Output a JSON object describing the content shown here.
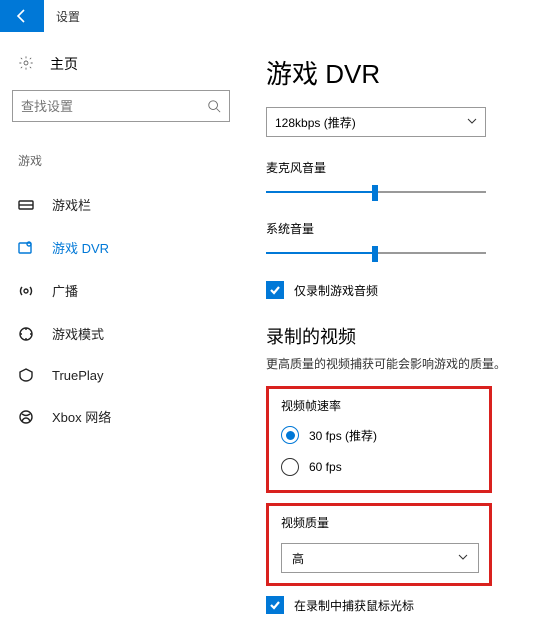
{
  "header": {
    "back_icon": "back",
    "title": "设置"
  },
  "sidebar": {
    "home_label": "主页",
    "search_placeholder": "查找设置",
    "category": "游戏",
    "items": [
      {
        "label": "游戏栏"
      },
      {
        "label": "游戏 DVR",
        "active": true
      },
      {
        "label": "广播"
      },
      {
        "label": "游戏模式"
      },
      {
        "label": "TruePlay"
      },
      {
        "label": "Xbox 网络"
      }
    ]
  },
  "main": {
    "title": "游戏 DVR",
    "bitrate_select": "128kbps (推荐)",
    "mic_label": "麦克风音量",
    "mic_value_pct": 48,
    "sys_label": "系统音量",
    "sys_value_pct": 48,
    "record_audio_only_label": "仅录制游戏音频",
    "record_audio_only_checked": true,
    "section_title": "录制的视频",
    "section_desc": "更高质量的视频捕获可能会影响游戏的质量。",
    "fps_label": "视频帧速率",
    "fps_options": [
      {
        "label": "30 fps (推荐)",
        "checked": true
      },
      {
        "label": "60 fps",
        "checked": false
      }
    ],
    "quality_label": "视频质量",
    "quality_value": "高",
    "mouse_label": "在录制中捕获鼠标光标",
    "mouse_checked": true
  }
}
